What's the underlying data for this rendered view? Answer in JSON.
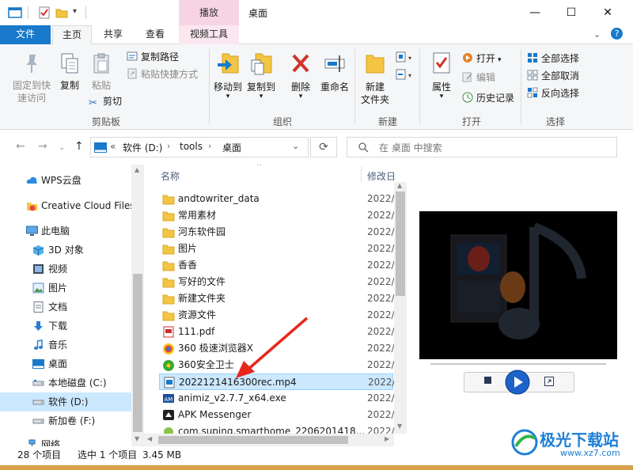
{
  "window": {
    "title": "桌面",
    "context_tab_header": "播放"
  },
  "tabs": [
    {
      "label": "文件"
    },
    {
      "label": "主页"
    },
    {
      "label": "共享"
    },
    {
      "label": "查看"
    },
    {
      "label": "视频工具"
    }
  ],
  "ribbon": {
    "clipboard": {
      "pin_label": "固定到快\n速访问",
      "pin_line1": "固定到快",
      "pin_line2": "速访问",
      "copy_label": "复制",
      "paste_label": "粘贴",
      "copy_path_label": "复制路径",
      "paste_shortcut_label": "粘贴快捷方式",
      "cut_label": "剪切",
      "group_label": "剪贴板"
    },
    "organize": {
      "move_to_label": "移动到",
      "copy_to_label": "复制到",
      "delete_label": "删除",
      "rename_label": "重命名",
      "group_label": "组织"
    },
    "new": {
      "new_folder_line1": "新建",
      "new_folder_line2": "文件夹",
      "group_label": "新建"
    },
    "open": {
      "properties_label": "属性",
      "open_label": "打开",
      "edit_label": "编辑",
      "history_label": "历史记录",
      "group_label": "打开"
    },
    "select": {
      "select_all_label": "全部选择",
      "select_none_label": "全部取消",
      "invert_label": "反向选择",
      "group_label": "选择"
    }
  },
  "address": {
    "prefix": "«",
    "crumbs": [
      "软件 (D:)",
      "tools",
      "桌面"
    ],
    "separator": "›",
    "search_placeholder": "在 桌面 中搜索"
  },
  "nav": {
    "items": [
      {
        "label": "WPS云盘",
        "icon": "cloud-icon"
      },
      {
        "label": "Creative Cloud Files",
        "icon": "creative-cloud-icon"
      },
      {
        "label": "此电脑",
        "icon": "computer-icon"
      },
      {
        "label": "3D 对象",
        "icon": "cube-icon"
      },
      {
        "label": "视频",
        "icon": "video-icon"
      },
      {
        "label": "图片",
        "icon": "picture-icon"
      },
      {
        "label": "文档",
        "icon": "document-icon"
      },
      {
        "label": "下载",
        "icon": "download-icon"
      },
      {
        "label": "音乐",
        "icon": "music-icon"
      },
      {
        "label": "桌面",
        "icon": "desktop-icon"
      },
      {
        "label": "本地磁盘 (C:)",
        "icon": "drive-icon"
      },
      {
        "label": "软件 (D:)",
        "icon": "drive-icon"
      },
      {
        "label": "新加卷 (F:)",
        "icon": "drive-icon"
      },
      {
        "label": "网络",
        "icon": "network-icon"
      }
    ]
  },
  "filelist": {
    "col_name": "名称",
    "col_date": "修改日",
    "files": [
      {
        "name": "andtowriter_data",
        "date": "2022/",
        "icon": "folder-icon"
      },
      {
        "name": "常用素材",
        "date": "2022/",
        "icon": "folder-icon"
      },
      {
        "name": "河东软件园",
        "date": "2022/",
        "icon": "folder-icon"
      },
      {
        "name": "图片",
        "date": "2022/",
        "icon": "folder-icon"
      },
      {
        "name": "香香",
        "date": "2022/",
        "icon": "folder-icon"
      },
      {
        "name": "写好的文件",
        "date": "2022/",
        "icon": "folder-icon"
      },
      {
        "name": "新建文件夹",
        "date": "2022/",
        "icon": "folder-icon"
      },
      {
        "name": "资源文件",
        "date": "2022/",
        "icon": "folder-icon"
      },
      {
        "name": "111.pdf",
        "date": "2022/",
        "icon": "pdf-icon"
      },
      {
        "name": "360 极速浏览器X",
        "date": "2022/",
        "icon": "browser-icon"
      },
      {
        "name": "360安全卫士",
        "date": "2022/",
        "icon": "shield-icon"
      },
      {
        "name": "20221214163​00rec.mp4",
        "date": "2022/",
        "icon": "video-file-icon"
      },
      {
        "name": "animiz_v2.7.7_x64.exe",
        "date": "2022/",
        "icon": "app-icon"
      },
      {
        "name": "APK Messenger",
        "date": "2022/",
        "icon": "apk-icon"
      },
      {
        "name": "com.suping.smarthome_2206201418...",
        "date": "2022/",
        "icon": "apk-file-icon"
      }
    ],
    "selected_index": 11
  },
  "status": {
    "count": "28 个项目",
    "selected": "选中 1 个项目",
    "size": "3.45 MB"
  },
  "watermark": {
    "text": "极光下载站",
    "url": "www.xz7.com"
  }
}
